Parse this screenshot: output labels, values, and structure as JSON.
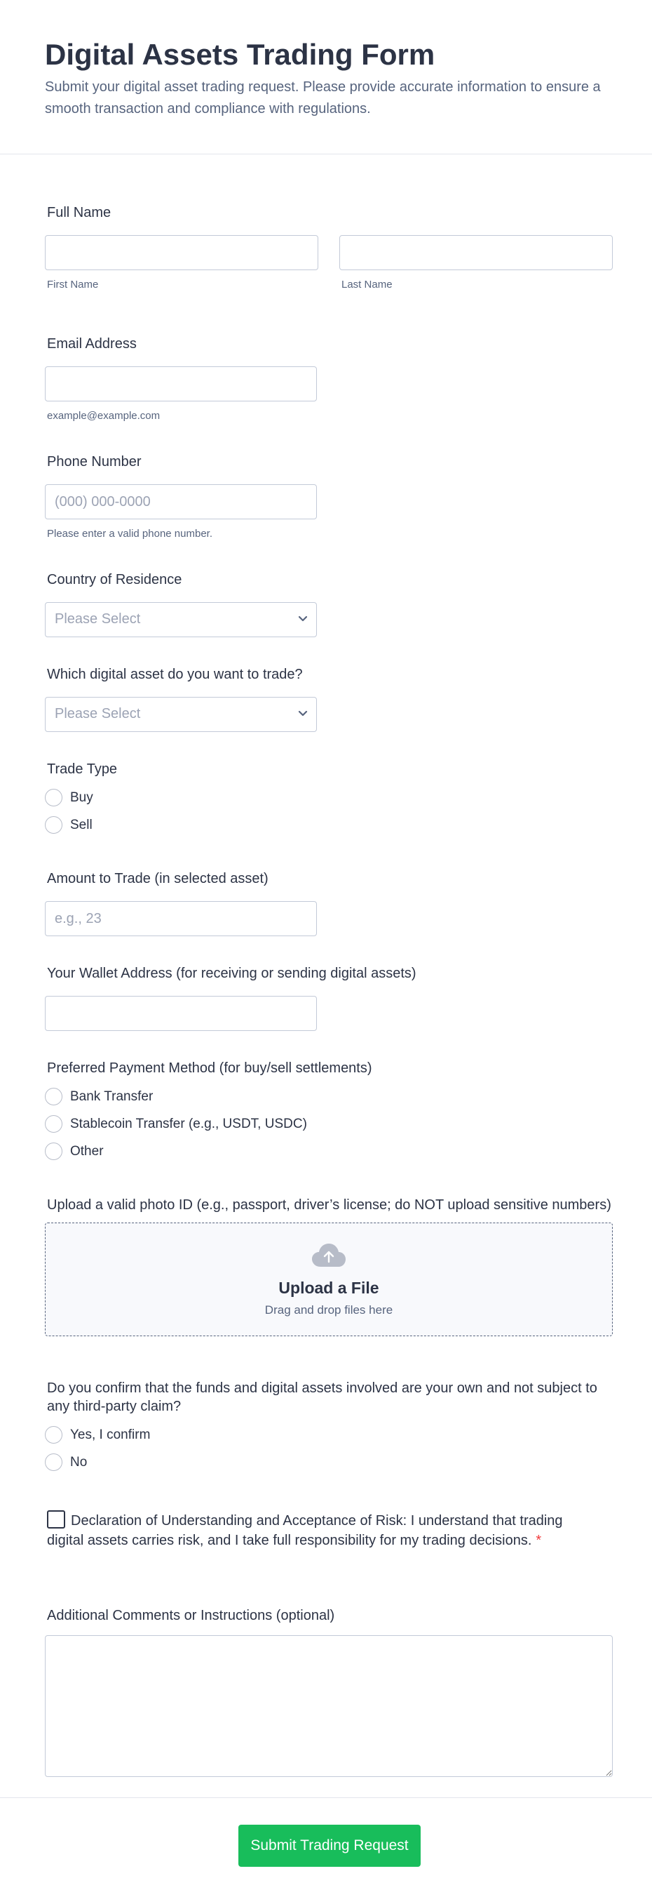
{
  "header": {
    "title": "Digital Assets Trading Form",
    "subtitle": "Submit your digital asset trading request. Please provide accurate information to ensure a smooth transaction and compliance with regulations."
  },
  "full_name": {
    "label": "Full Name",
    "first_sublabel": "First Name",
    "last_sublabel": "Last Name",
    "first_value": "",
    "last_value": ""
  },
  "email": {
    "label": "Email Address",
    "sublabel": "example@example.com",
    "value": ""
  },
  "phone": {
    "label": "Phone Number",
    "placeholder": "(000) 000-0000",
    "sublabel": "Please enter a valid phone number."
  },
  "country": {
    "label": "Country of Residence",
    "selected": "Please Select"
  },
  "asset": {
    "label": "Which digital asset do you want to trade?",
    "selected": "Please Select"
  },
  "trade_type": {
    "label": "Trade Type",
    "options": [
      "Buy",
      "Sell"
    ]
  },
  "amount": {
    "label": "Amount to Trade (in selected asset)",
    "placeholder": "e.g., 23"
  },
  "wallet": {
    "label": "Your Wallet Address (for receiving or sending digital assets)",
    "value": ""
  },
  "payment": {
    "label": "Preferred Payment Method (for buy/sell settlements)",
    "options": [
      "Bank Transfer",
      "Stablecoin Transfer (e.g., USDT, USDC)",
      "Other"
    ]
  },
  "upload": {
    "label": "Upload a valid photo ID (e.g., passport, driver’s license; do NOT upload sensitive numbers)",
    "icon": "cloud-upload-icon",
    "title": "Upload a File",
    "subtitle": "Drag and drop files here"
  },
  "funds_confirm": {
    "label": "Do you confirm that the funds and digital assets involved are your own and not subject to any third-party claim?",
    "options": [
      "Yes, I confirm",
      "No"
    ]
  },
  "declaration": {
    "text": "Declaration of Understanding and Acceptance of Risk: I understand that trading digital assets carries risk, and I take full responsibility for my trading decisions.",
    "required_mark": "*"
  },
  "comments": {
    "label": "Additional Comments or Instructions (optional)",
    "value": ""
  },
  "submit": {
    "label": "Submit Trading Request"
  },
  "colors": {
    "accent": "#18bd5b",
    "text": "#2c3345",
    "muted": "#57647e",
    "border": "#c3cad8",
    "required": "#f23a3c"
  }
}
